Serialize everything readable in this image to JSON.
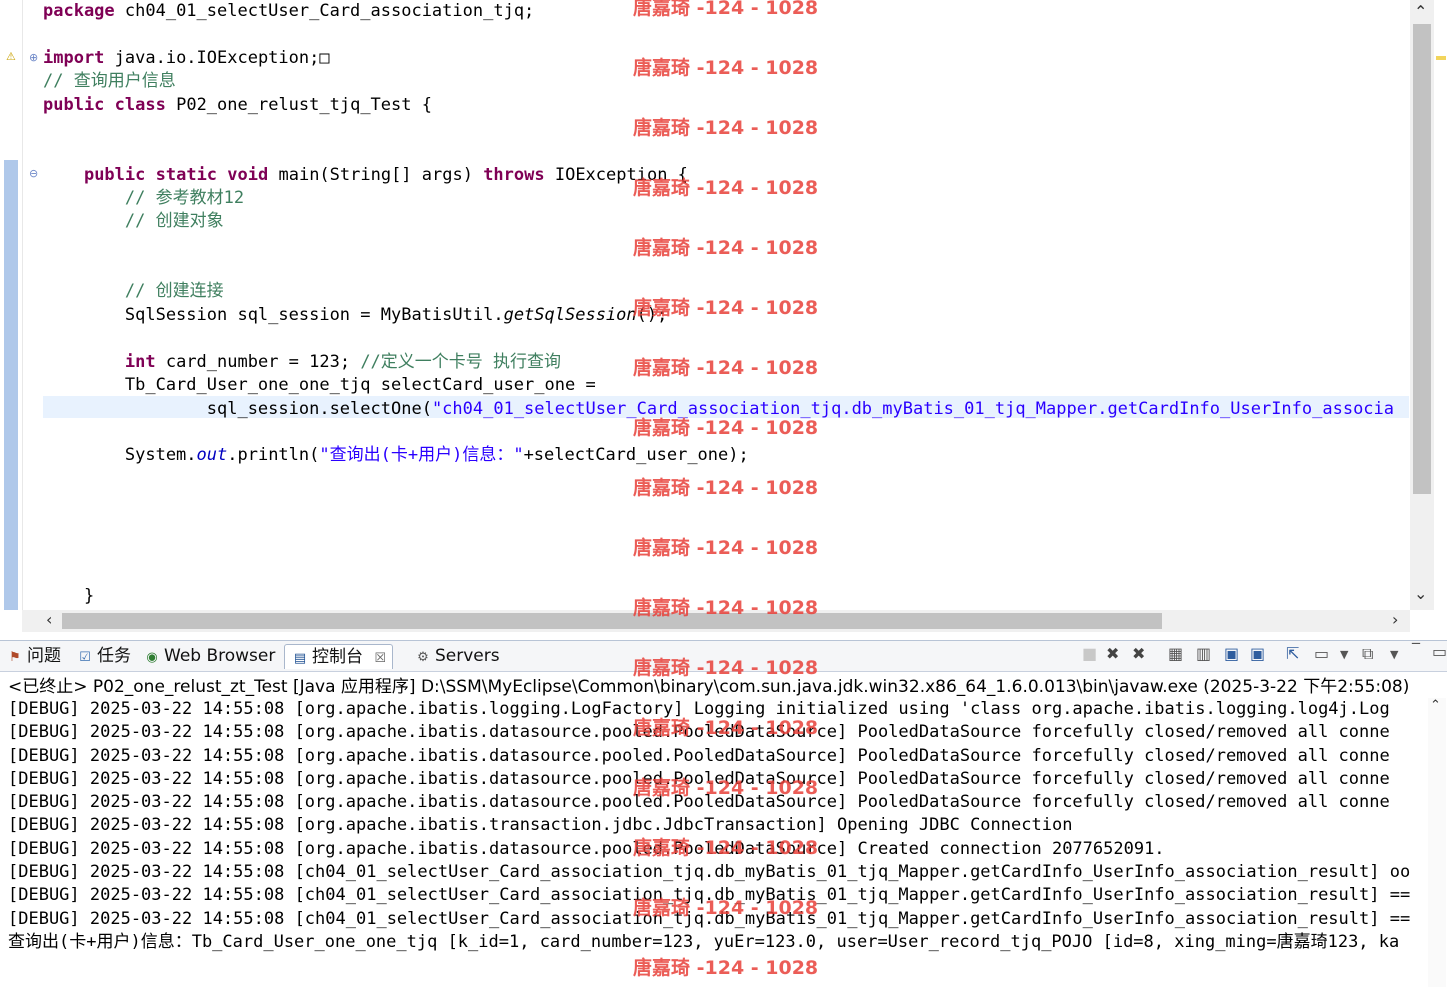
{
  "editor": {
    "lines": [
      {
        "n": "l01",
        "parts": [
          {
            "t": "package",
            "c": "kw"
          },
          {
            "t": " ch04_01_selectUser_Card_association_tjq;"
          }
        ]
      },
      {
        "n": "l03",
        "parts": [
          {
            "t": "import",
            "c": "kw"
          },
          {
            "t": " java.io.IOException;"
          },
          {
            "t": "□"
          }
        ]
      },
      {
        "n": "l04",
        "parts": [
          {
            "t": "// 查询用户信息",
            "c": "cm"
          }
        ]
      },
      {
        "n": "l05",
        "parts": [
          {
            "t": "public",
            "c": "kw"
          },
          {
            "t": " "
          },
          {
            "t": "class",
            "c": "kw"
          },
          {
            "t": " P02_one_relust_tjq_Test {"
          }
        ]
      },
      {
        "n": "l08",
        "parts": [
          {
            "t": "    "
          },
          {
            "t": "public",
            "c": "kw"
          },
          {
            "t": " "
          },
          {
            "t": "static",
            "c": "kw"
          },
          {
            "t": " "
          },
          {
            "t": "void",
            "c": "kw"
          },
          {
            "t": " main(String[] args) "
          },
          {
            "t": "throws",
            "c": "kw"
          },
          {
            "t": " IOException {"
          }
        ]
      },
      {
        "n": "l09",
        "parts": [
          {
            "t": "        "
          },
          {
            "t": "// 参考教材12",
            "c": "cm"
          }
        ]
      },
      {
        "n": "l10",
        "parts": [
          {
            "t": "        "
          },
          {
            "t": "// 创建对象",
            "c": "cm"
          }
        ]
      },
      {
        "n": "l13",
        "parts": [
          {
            "t": "        "
          },
          {
            "t": "// 创建连接",
            "c": "cm"
          }
        ]
      },
      {
        "n": "l14",
        "parts": [
          {
            "t": "        SqlSession sql_session = MyBatisUtil."
          },
          {
            "t": "getSqlSession",
            "c": "it"
          },
          {
            "t": "();"
          }
        ]
      },
      {
        "n": "l16",
        "parts": [
          {
            "t": "        "
          },
          {
            "t": "int",
            "c": "kw"
          },
          {
            "t": " card_number = 123; "
          },
          {
            "t": "//定义一个卡号 执行查询",
            "c": "cm"
          }
        ]
      },
      {
        "n": "l17",
        "parts": [
          {
            "t": "        Tb_Card_User_one_one_tjq selectCard_user_one ="
          }
        ]
      },
      {
        "n": "l18",
        "parts": [
          {
            "t": "                sql_session.selectOne("
          },
          {
            "t": "\"ch04_01_selectUser_Card_association_tjq.db_myBatis_01_tjq_Mapper.getCardInfo_UserInfo_associa",
            "c": "str"
          }
        ]
      },
      {
        "n": "l20",
        "parts": [
          {
            "t": "        System."
          },
          {
            "t": "out",
            "c": "fld"
          },
          {
            "t": ".println("
          },
          {
            "t": "\"查询出(卡+用户)信息：\"",
            "c": "str"
          },
          {
            "t": "+selectCard_user_one);"
          }
        ]
      },
      {
        "n": "l26",
        "parts": [
          {
            "t": "    }"
          }
        ]
      }
    ]
  },
  "panel": {
    "tabs": [
      {
        "icon": "problems-icon",
        "label": "问题"
      },
      {
        "icon": "tasks-icon",
        "label": "任务"
      },
      {
        "icon": "web-browser-icon",
        "label": "Web Browser"
      },
      {
        "icon": "console-icon",
        "label": "控制台"
      },
      {
        "icon": "servers-icon",
        "label": "Servers"
      }
    ],
    "active_tab": "控制台",
    "close_glyph": "☒"
  },
  "console": {
    "header": "<已终止> P02_one_relust_zt_Test [Java 应用程序] D:\\SSM\\MyEclipse\\Common\\binary\\com.sun.java.jdk.win32.x86_64_1.6.0.013\\bin\\javaw.exe  (2025-3-22 下午2:55:08)",
    "lines": [
      "[DEBUG] 2025-03-22 14:55:08 [org.apache.ibatis.logging.LogFactory] Logging initialized using 'class org.apache.ibatis.logging.log4j.Log",
      "[DEBUG] 2025-03-22 14:55:08 [org.apache.ibatis.datasource.pooled.PooledDataSource] PooledDataSource forcefully closed/removed all conne",
      "[DEBUG] 2025-03-22 14:55:08 [org.apache.ibatis.datasource.pooled.PooledDataSource] PooledDataSource forcefully closed/removed all conne",
      "[DEBUG] 2025-03-22 14:55:08 [org.apache.ibatis.datasource.pooled.PooledDataSource] PooledDataSource forcefully closed/removed all conne",
      "[DEBUG] 2025-03-22 14:55:08 [org.apache.ibatis.datasource.pooled.PooledDataSource] PooledDataSource forcefully closed/removed all conne",
      "[DEBUG] 2025-03-22 14:55:08 [org.apache.ibatis.transaction.jdbc.JdbcTransaction] Opening JDBC Connection",
      "[DEBUG] 2025-03-22 14:55:08 [org.apache.ibatis.datasource.pooled.PooledDataSource] Created connection 2077652091.",
      "[DEBUG] 2025-03-22 14:55:08 [ch04_01_selectUser_Card_association_tjq.db_myBatis_01_tjq_Mapper.getCardInfo_UserInfo_association_result] oo",
      "[DEBUG] 2025-03-22 14:55:08 [ch04_01_selectUser_Card_association_tjq.db_myBatis_01_tjq_Mapper.getCardInfo_UserInfo_association_result] ==",
      "[DEBUG] 2025-03-22 14:55:08 [ch04_01_selectUser_Card_association_tjq.db_myBatis_01_tjq_Mapper.getCardInfo_UserInfo_association_result] ==",
      "查询出(卡+用户)信息：Tb_Card_User_one_one_tjq [k_id=1, card_number=123, yuEr=123.0, user=User_record_tjq_POJO [id=8, xing_ming=唐嘉琦123, ka"
    ]
  },
  "watermark": "唐嘉琦 -124 - 1028",
  "colors": {
    "keyword": "#7f0055",
    "comment": "#3f7f5f",
    "string": "#2a00ff",
    "watermark": "#e8413a",
    "current_line": "#e8f2fe"
  }
}
